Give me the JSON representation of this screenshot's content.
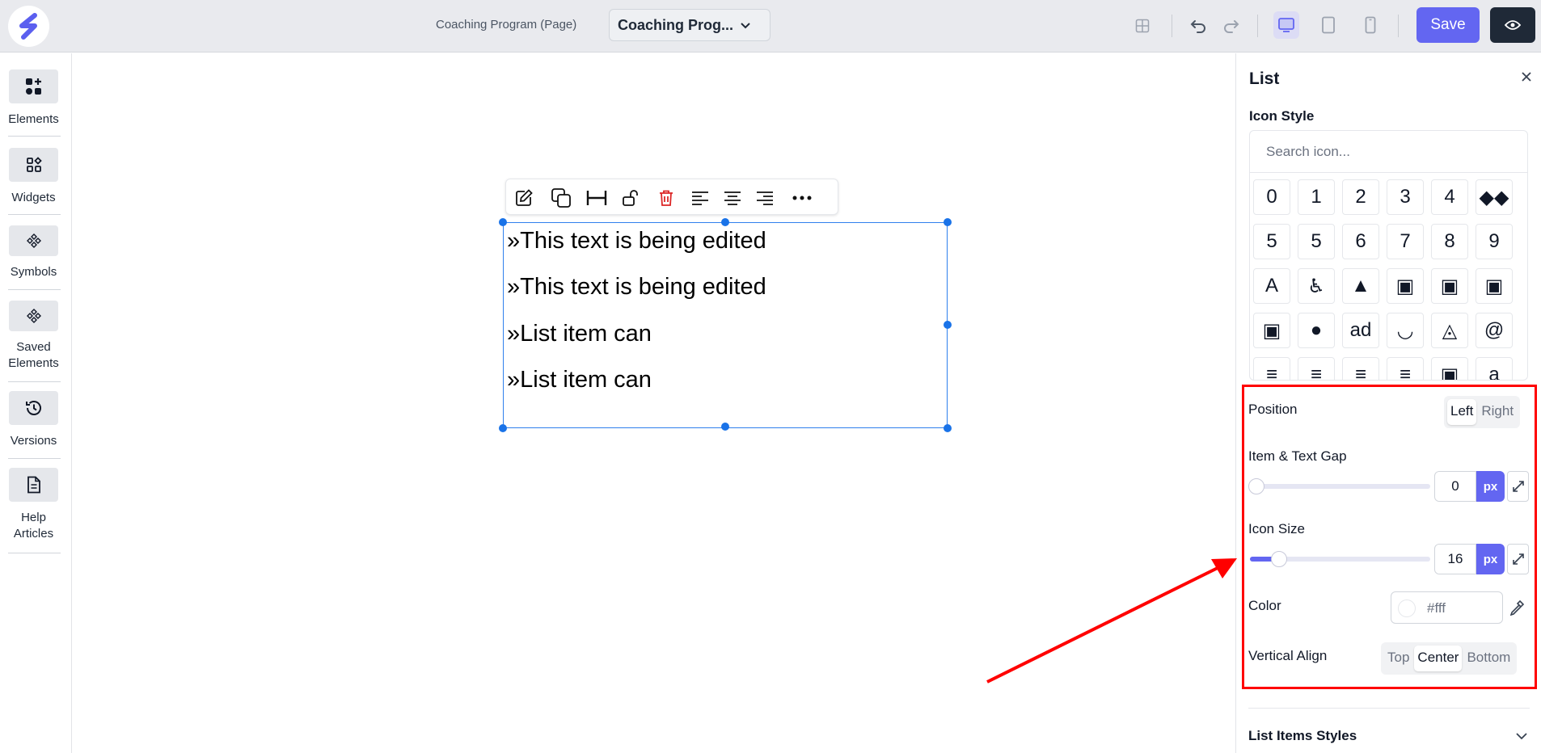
{
  "header": {
    "page_label": "Coaching Program (Page)",
    "page_select_value": "Coaching Prog...",
    "save_label": "Save"
  },
  "sidebar": {
    "items": [
      {
        "label": "Elements",
        "icon": "elements-icon"
      },
      {
        "label": "Widgets",
        "icon": "widgets-icon"
      },
      {
        "label": "Symbols",
        "icon": "symbols-icon"
      },
      {
        "label": "Saved Elements",
        "icon": "saved-elements-icon"
      },
      {
        "label": "Versions",
        "icon": "history-icon"
      },
      {
        "label": "Help Articles",
        "icon": "document-icon"
      }
    ]
  },
  "canvas": {
    "list_items": [
      "»This text is being edited",
      "»This text is being edited",
      "»List item can",
      "»List item can"
    ]
  },
  "panel": {
    "title": "List",
    "icon_style_label": "Icon Style",
    "search_placeholder": "Search icon...",
    "icon_grid": [
      [
        "0",
        "1",
        "2",
        "3",
        "4",
        "◆◆"
      ],
      [
        "5",
        "5",
        "6",
        "7",
        "8",
        "9"
      ],
      [
        "A",
        "♿",
        "▲",
        "▣",
        "▣",
        "▣"
      ],
      [
        "▣",
        "●",
        "ad",
        "◡",
        "◬",
        "@"
      ],
      [
        "≡",
        "≡",
        "≡",
        "≡",
        "▣",
        "a"
      ]
    ],
    "position_label": "Position",
    "position_options": [
      "Left",
      "Right"
    ],
    "position_selected": "Left",
    "gap_label": "Item & Text Gap",
    "gap_value": "0",
    "gap_unit": "px",
    "icon_size_label": "Icon Size",
    "icon_size_value": "16",
    "icon_size_unit": "px",
    "icon_size_fraction": 0.16,
    "color_label": "Color",
    "color_value": "#fff",
    "valign_label": "Vertical Align",
    "valign_options": [
      "Top",
      "Center",
      "Bottom"
    ],
    "valign_selected": "Center",
    "list_items_styles_label": "List Items Styles"
  },
  "colors": {
    "accent": "#6366f1",
    "annotation": "#ff0000",
    "selection": "#2f80ed"
  }
}
